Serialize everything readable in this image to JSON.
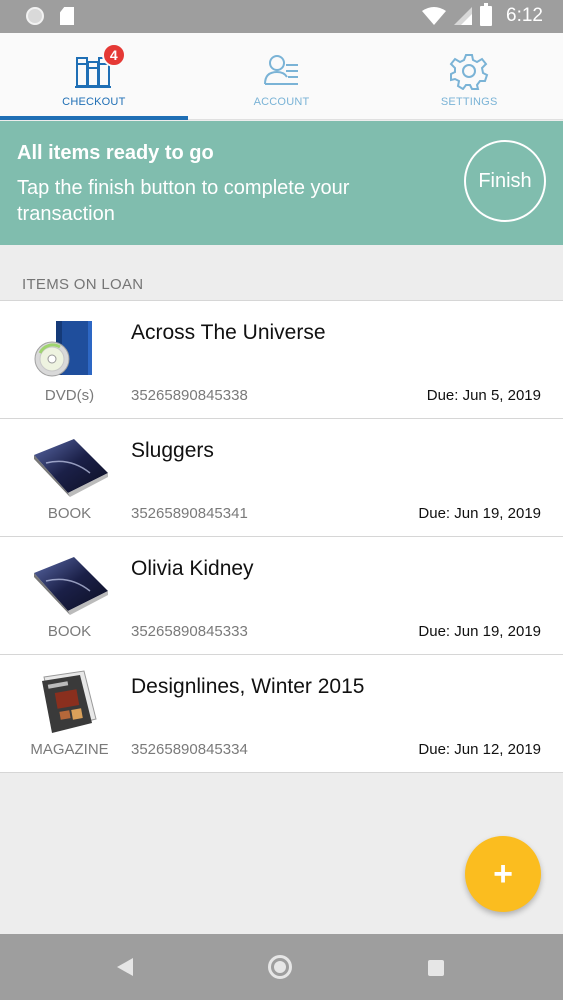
{
  "status_bar": {
    "time": "6:12",
    "icons": [
      "circle-icon",
      "sd-card-icon",
      "wifi-icon",
      "signal-icon",
      "battery-icon"
    ]
  },
  "tabs": [
    {
      "label": "CHECKOUT",
      "icon": "books-icon",
      "badge": "4",
      "active": true
    },
    {
      "label": "ACCOUNT",
      "icon": "user-card-icon",
      "active": false
    },
    {
      "label": "SETTINGS",
      "icon": "gear-icon",
      "active": false
    }
  ],
  "banner": {
    "title": "All items ready to go",
    "text": "Tap the finish button to complete your transaction",
    "finish_label": "Finish",
    "color": "#80bdae"
  },
  "section_header": "ITEMS ON LOAN",
  "items": [
    {
      "title": "Across The Universe",
      "type": "DVD(s)",
      "barcode": "35265890845338",
      "due": "Due: Jun 5, 2019",
      "thumb": "dvd-icon"
    },
    {
      "title": "Sluggers",
      "type": "BOOK",
      "barcode": "35265890845341",
      "due": "Due: Jun 19, 2019",
      "thumb": "book-icon"
    },
    {
      "title": "Olivia Kidney",
      "type": "BOOK",
      "barcode": "35265890845333",
      "due": "Due: Jun 19, 2019",
      "thumb": "book-icon"
    },
    {
      "title": "Designlines, Winter 2015",
      "type": "MAGAZINE",
      "barcode": "35265890845334",
      "due": "Due: Jun 12, 2019",
      "thumb": "magazine-icon"
    }
  ],
  "fab": {
    "label": "+",
    "color": "#fbbd1f"
  },
  "nav_bar": {
    "icons": [
      "back-icon",
      "home-icon",
      "recents-icon"
    ]
  },
  "colors": {
    "accent": "#1f6fb5",
    "badge": "#e53935"
  }
}
